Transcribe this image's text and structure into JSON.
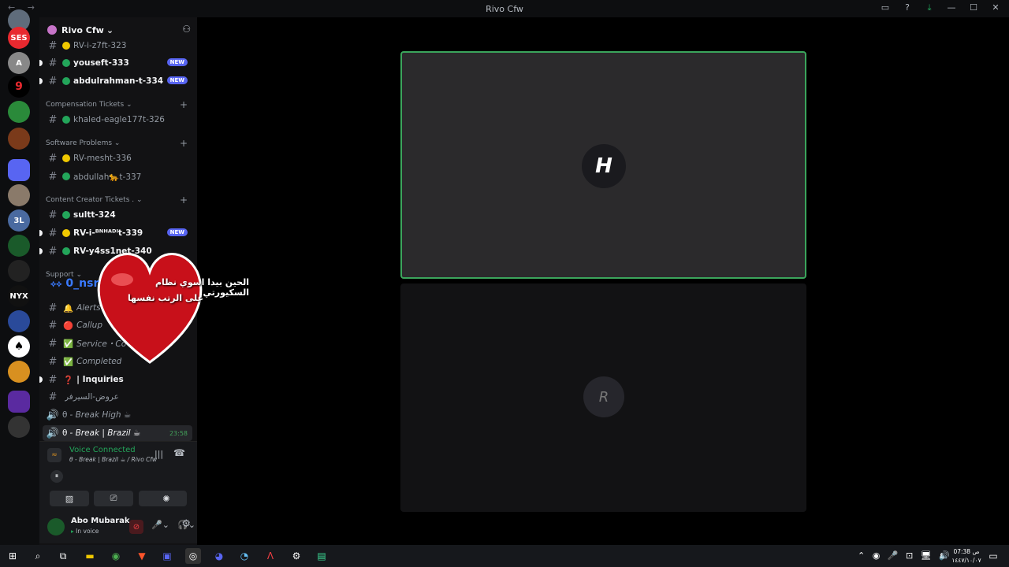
{
  "window": {
    "title": "Rivo Cfw",
    "nav": "← →"
  },
  "server": {
    "name": "Rivo Cfw"
  },
  "channels": [
    {
      "name": "RV-i-z7ft-323",
      "dot": "#f0c800",
      "unread": false
    },
    {
      "name": "youseft-333",
      "dot": "#23a55a",
      "unread": true,
      "new": "NEW"
    },
    {
      "name": "abdulrahman-t-334",
      "dot": "#23a55a",
      "unread": true,
      "new": "NEW"
    }
  ],
  "categories": {
    "compensation": "Compensation Tickets",
    "software": "Software Problems",
    "content": "Content Creator Tickets .",
    "support": "Support"
  },
  "comp_channels": [
    {
      "name": "khaled-eagle177t-326",
      "dot": "#23a55a"
    }
  ],
  "soft_channels": [
    {
      "name": "RV-mesht-336",
      "dot": "#f0c800"
    },
    {
      "name": "abdullah🐆t-337",
      "dot": "#23a55a"
    }
  ],
  "content_channels": [
    {
      "name": "sultt-324",
      "dot": "#23a55a",
      "unread": true
    },
    {
      "name": "RV-i-ᴮᴺᴴᴬᴰᴵt-339",
      "dot": "#f0c800",
      "unread": true,
      "new": "NEW"
    },
    {
      "name": "RV-y4ss1net-340",
      "dot": "#23a55a",
      "unread": true
    }
  ],
  "support_channels": [
    {
      "name": "Alerts",
      "emoji": "🔔"
    },
    {
      "name": "Callup",
      "emoji": "🔴"
    },
    {
      "name": "Service・Co",
      "emoji": "✅"
    },
    {
      "name": "Completed",
      "emoji": "✅"
    },
    {
      "name": "| Inquiries",
      "emoji": "❓"
    },
    {
      "name": "عروض-السيرفر",
      "emoji": ""
    }
  ],
  "voice_channels": [
    {
      "name": "- Break High ☕",
      "prefix": "θ"
    },
    {
      "name": "- Break | Brazil ☕",
      "prefix": "θ",
      "time": "23:58"
    }
  ],
  "voice": {
    "status": "Voice Connected",
    "channel": "θ - Break | Brazil ☕ / Rivo Cfw"
  },
  "user": {
    "name": "Abo Mubarak",
    "status": "In voice"
  },
  "overlay": {
    "user": "0_nsr",
    "line1": "الحين بيدا اسوي نظام السكيورتي",
    "line2": "على الرتب نفسها"
  },
  "taskbar": {
    "time": "07:38 ص",
    "date": "١٤٤٧/١٠/٠٧",
    "lang": "ع"
  }
}
